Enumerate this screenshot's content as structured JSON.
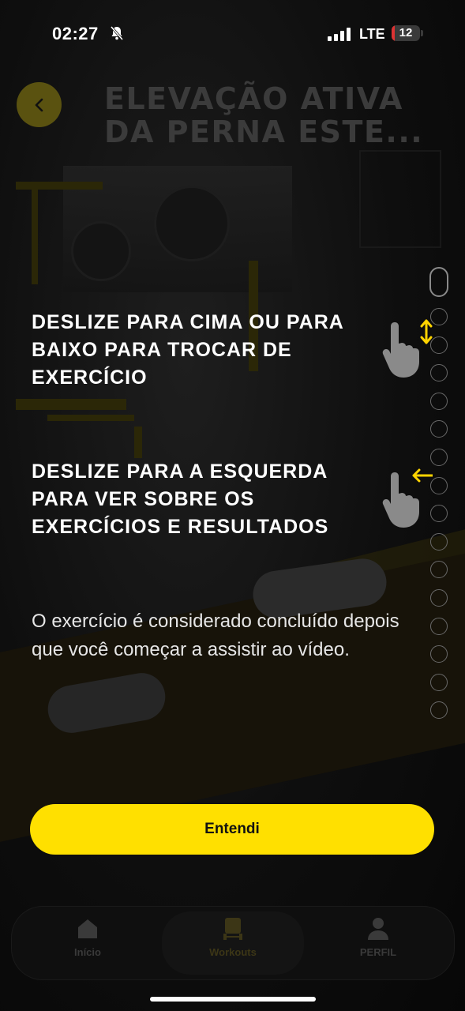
{
  "status_bar": {
    "time": "02:27",
    "network": "LTE",
    "battery": "12"
  },
  "header": {
    "back_icon": "chevron-left-icon",
    "title": "ELEVAÇÃO ATIVA DA PERNA ESTE..."
  },
  "instructions": {
    "swipe_vertical": "DESLIZE PARA CIMA OU PARA BAIXO PARA TROCAR DE EXERCÍCIO",
    "swipe_horizontal": "DESLIZE PARA A ESQUERDA PARA VER SOBRE OS EXERCÍCIOS E RESULTADOS",
    "note": "O exercício é considerado concluído depois que você começar a assistir ao vídeo."
  },
  "button": {
    "label": "Entendi"
  },
  "tabs": [
    {
      "label": "Início",
      "icon": "home-icon"
    },
    {
      "label": "Workouts",
      "icon": "dumbbell-icon"
    },
    {
      "label": "PERFIL",
      "icon": "user-icon"
    }
  ],
  "colors": {
    "accent": "#ffe000",
    "background": "#0b0b0b",
    "arrow": "#ffd400"
  }
}
